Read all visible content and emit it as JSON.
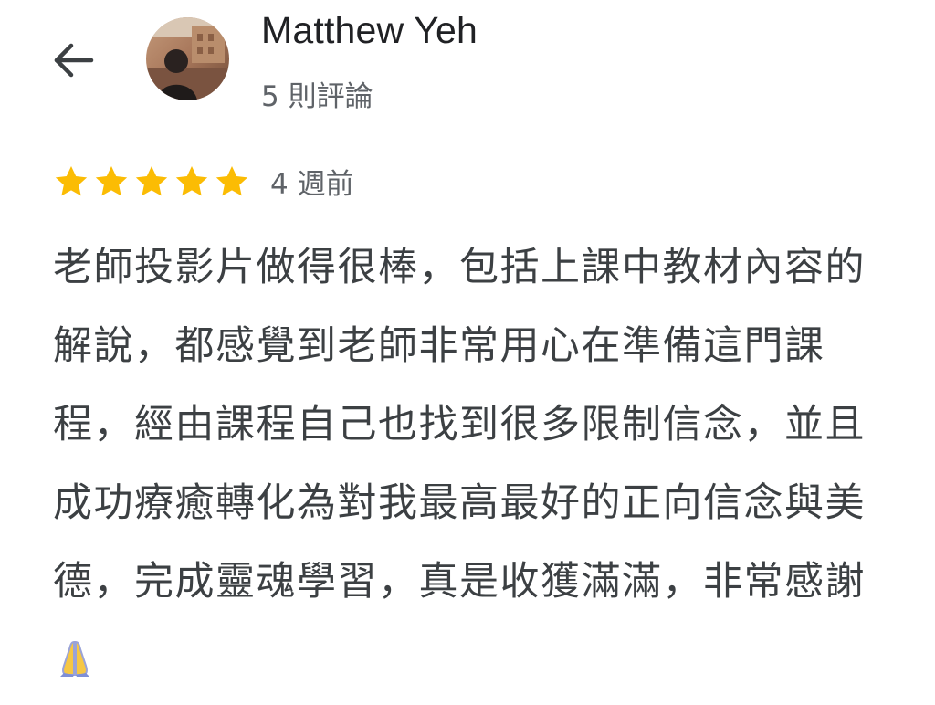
{
  "header": {
    "back_icon": "arrow-left-icon",
    "avatar_icon": "avatar-photo",
    "reviewer_name": "Matthew Yeh",
    "review_count": "5 則評論"
  },
  "review": {
    "rating": 5,
    "rating_max": 5,
    "star_color": "#fbbc04",
    "date": "4 週前",
    "text": "老師投影片做得很棒，包括上課中教材內容的解說，都感覺到老師非常用心在準備這門課程，經由課程自己也找到很多限制信念，並且成功療癒轉化為對我最高最好的正向信念與美德，完成靈魂學習，真是收獲滿滿，非常感謝",
    "emoji_icon": "folded-hands-emoji"
  }
}
